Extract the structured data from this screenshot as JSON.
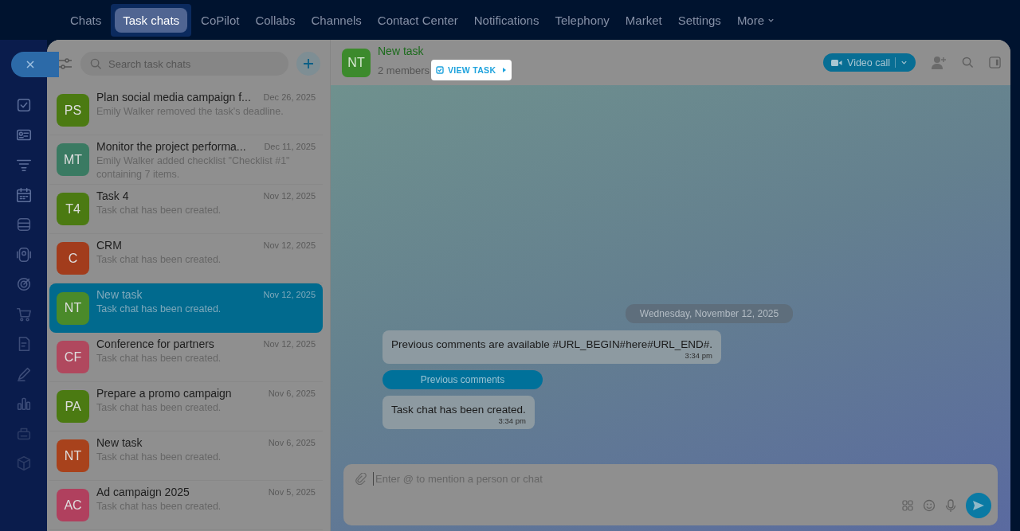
{
  "nav": {
    "tabs": [
      {
        "label": "Chats",
        "selected": false
      },
      {
        "label": "Task chats",
        "selected": true
      },
      {
        "label": "CoPilot",
        "selected": false
      },
      {
        "label": "Collabs",
        "selected": false
      },
      {
        "label": "Channels",
        "selected": false
      },
      {
        "label": "Contact Center",
        "selected": false
      },
      {
        "label": "Notifications",
        "selected": false
      },
      {
        "label": "Telephony",
        "selected": false
      },
      {
        "label": "Market",
        "selected": false
      },
      {
        "label": "Settings",
        "selected": false
      },
      {
        "label": "More",
        "selected": false
      }
    ]
  },
  "chat_list": {
    "search": {
      "placeholder": "Search task chats"
    },
    "chats": [
      {
        "initials": "PS",
        "color": "#4b7a12",
        "title": "Plan social media campaign f...",
        "date": "Dec 26, 2025",
        "preview": "Emily Walker removed the task's deadline.",
        "selected": false
      },
      {
        "initials": "MT",
        "color": "#3a7a62",
        "title": "Monitor the project performa...",
        "date": "Dec 11, 2025",
        "preview": "Emily Walker added checklist \"Checklist #1\" containing 7 items.",
        "selected": false
      },
      {
        "initials": "T4",
        "color": "#4b7a12",
        "title": "Task 4",
        "date": "Nov 12, 2025",
        "preview": "Task chat has been created.",
        "selected": false
      },
      {
        "initials": "C",
        "color": "#a23c1c",
        "title": "CRM",
        "date": "Nov 12, 2025",
        "preview": "Task chat has been created.",
        "selected": false
      },
      {
        "initials": "NT",
        "color": "#4a8a2a",
        "title": "New task",
        "date": "Nov 12, 2025",
        "preview": "Task chat has been created.",
        "selected": true
      },
      {
        "initials": "CF",
        "color": "#b0485e",
        "title": "Conference for partners",
        "date": "Nov 12, 2025",
        "preview": "Task chat has been created.",
        "selected": false
      },
      {
        "initials": "PA",
        "color": "#4b7a12",
        "title": "Prepare a promo campaign",
        "date": "Nov 6, 2025",
        "preview": "Task chat has been created.",
        "selected": false
      },
      {
        "initials": "NT",
        "color": "#a8421c",
        "title": "New task",
        "date": "Nov 6, 2025",
        "preview": "Task chat has been created.",
        "selected": false
      },
      {
        "initials": "AC",
        "color": "#b0405e",
        "title": "Ad campaign 2025",
        "date": "Nov 5, 2025",
        "preview": "Task chat has been created.",
        "selected": false
      }
    ]
  },
  "chat": {
    "initials": "NT",
    "title": "New task",
    "members": "2 members",
    "view_task": "VIEW TASK",
    "video_call": "Video call",
    "date_separator": "Wednesday, November 12, 2025",
    "messages": [
      {
        "kind": "text",
        "text": "Previous comments are available #URL_BEGIN#here#URL_END#.",
        "time": "3:34 pm"
      },
      {
        "kind": "button",
        "text": "Previous comments"
      },
      {
        "kind": "text",
        "text": "Task chat has been created.",
        "time": "3:34 pm"
      }
    ],
    "input": {
      "placeholder": "Enter @ to mention a person or chat"
    }
  }
}
